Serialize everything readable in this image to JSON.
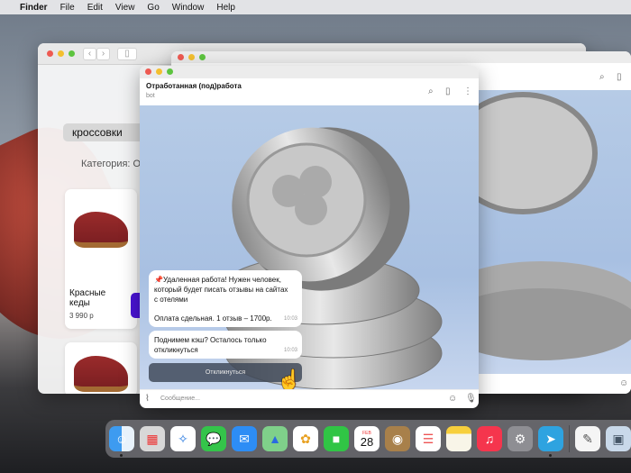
{
  "menubar": {
    "items": [
      "Finder",
      "File",
      "Edit",
      "View",
      "Go",
      "Window",
      "Help"
    ]
  },
  "safari": {
    "search_value": "кроссовки",
    "category": "Категория: Об",
    "product": {
      "name": "Красные кеды",
      "price": "3 990 р"
    }
  },
  "telegram": {
    "chat_title": "Отработанная (под)работа",
    "chat_subtitle": "bot",
    "messages": [
      {
        "text_lines": [
          "📌Удаленная работа! Нужен человек,",
          "который будет писать отзывы на сайтах",
          "с отелями"
        ],
        "text2": "Оплата сдельная. 1 отзыв – 1700р.",
        "time": "10:03"
      },
      {
        "text_lines": [
          "Поднимем кэш? Осталось только",
          "откликнуться"
        ],
        "time": "10:03"
      }
    ],
    "respond_button": "Откликнуться",
    "input_placeholder": "Сообщение..."
  },
  "dock": {
    "apps": [
      "Finder",
      "Launchpad",
      "Safari",
      "Messages",
      "Mail",
      "Maps",
      "Photos",
      "FaceTime",
      "Calendar",
      "Contacts",
      "Reminders",
      "Notes",
      "Music",
      "System Preferences",
      "Telegram",
      "TextEdit",
      "Preview"
    ],
    "calendar": {
      "month": "FEB",
      "day": "28"
    }
  }
}
